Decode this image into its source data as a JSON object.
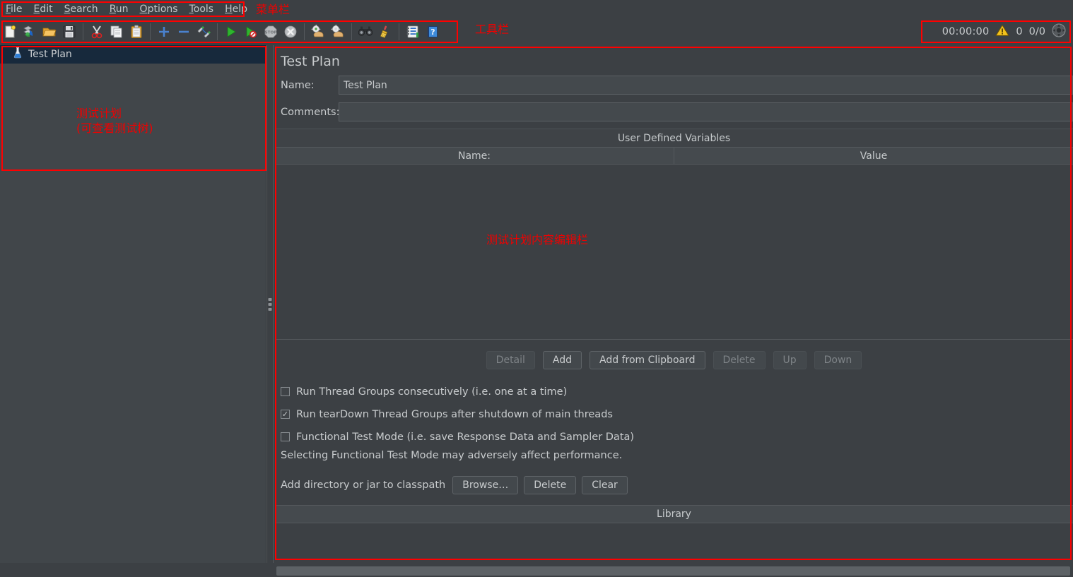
{
  "menubar": {
    "items": [
      {
        "pre": "",
        "mnemonic": "F",
        "post": "ile"
      },
      {
        "pre": "",
        "mnemonic": "E",
        "post": "dit"
      },
      {
        "pre": "",
        "mnemonic": "S",
        "post": "earch"
      },
      {
        "pre": "",
        "mnemonic": "R",
        "post": "un"
      },
      {
        "pre": "",
        "mnemonic": "O",
        "post": "ptions"
      },
      {
        "pre": "",
        "mnemonic": "T",
        "post": "ools"
      },
      {
        "pre": "",
        "mnemonic": "H",
        "post": "elp"
      }
    ]
  },
  "toolbar": {
    "icons": [
      {
        "name": "new-icon",
        "title": "New"
      },
      {
        "name": "templates-icon",
        "title": "Templates"
      },
      {
        "name": "open-icon",
        "title": "Open"
      },
      {
        "name": "save-icon",
        "title": "Save Test Plan"
      },
      {
        "name": "cut-icon",
        "title": "Cut"
      },
      {
        "name": "copy-icon",
        "title": "Copy"
      },
      {
        "name": "paste-icon",
        "title": "Paste"
      },
      {
        "name": "expand-all-icon",
        "title": "Expand All"
      },
      {
        "name": "collapse-all-icon",
        "title": "Collapse All"
      },
      {
        "name": "toggle-icon",
        "title": "Toggle"
      },
      {
        "name": "start-icon",
        "title": "Start"
      },
      {
        "name": "start-no-timers-icon",
        "title": "Start no pauses"
      },
      {
        "name": "stop-icon",
        "title": "Stop"
      },
      {
        "name": "shutdown-icon",
        "title": "Shutdown"
      },
      {
        "name": "clear-icon",
        "title": "Clear"
      },
      {
        "name": "clear-all-icon",
        "title": "Clear All"
      },
      {
        "name": "search-icon",
        "title": "Search"
      },
      {
        "name": "reset-search-icon",
        "title": "Reset Search"
      },
      {
        "name": "function-helper-icon",
        "title": "Function Helper Dialog"
      },
      {
        "name": "help-icon",
        "title": "Help"
      }
    ]
  },
  "status": {
    "elapsed": "00:00:00",
    "warning_count": "0",
    "threads_ratio": "0/0",
    "warning_icon": "warning-triangle-icon",
    "remote_icon": "connection-icon"
  },
  "tree": {
    "root_label": "Test Plan",
    "root_icon": "test-plan-flask-icon"
  },
  "main": {
    "title": "Test Plan",
    "name_label": "Name:",
    "name_value": "Test Plan",
    "comments_label": "Comments:",
    "comments_value": "",
    "udv_section_title": "User Defined Variables",
    "udv_columns": [
      "Name:",
      "Value"
    ],
    "udv_rows": [],
    "buttons": [
      {
        "label": "Detail",
        "name": "detail-button",
        "disabled": true
      },
      {
        "label": "Add",
        "name": "add-button",
        "disabled": false
      },
      {
        "label": "Add from Clipboard",
        "name": "add-from-clipboard-button",
        "disabled": false
      },
      {
        "label": "Delete",
        "name": "delete-variable-button",
        "disabled": true
      },
      {
        "label": "Up",
        "name": "move-up-button",
        "disabled": true
      },
      {
        "label": "Down",
        "name": "move-down-button",
        "disabled": true
      }
    ],
    "checkboxes": [
      {
        "label": "Run Thread Groups consecutively (i.e. one at a time)",
        "name": "run-consecutively-checkbox",
        "checked": false
      },
      {
        "label": "Run tearDown Thread Groups after shutdown of main threads",
        "name": "run-teardown-checkbox",
        "checked": true
      },
      {
        "label": "Functional Test Mode (i.e. save Response Data and Sampler Data)",
        "name": "functional-test-mode-checkbox",
        "checked": false
      }
    ],
    "functional_note": "Selecting Functional Test Mode may adversely affect performance.",
    "classpath_label": "Add directory or jar to classpath",
    "classpath_buttons": [
      {
        "label": "Browse…",
        "name": "browse-button"
      },
      {
        "label": "Delete",
        "name": "delete-classpath-button"
      },
      {
        "label": "Clear",
        "name": "clear-classpath-button"
      }
    ],
    "library_header": "Library",
    "library_rows": []
  },
  "annotations": {
    "menubar": "菜单栏",
    "toolbar": "工具栏",
    "tree": "测试计划\n(可查看测试树)",
    "main": "测试计划内容编辑栏",
    "color": "#ff0000"
  }
}
